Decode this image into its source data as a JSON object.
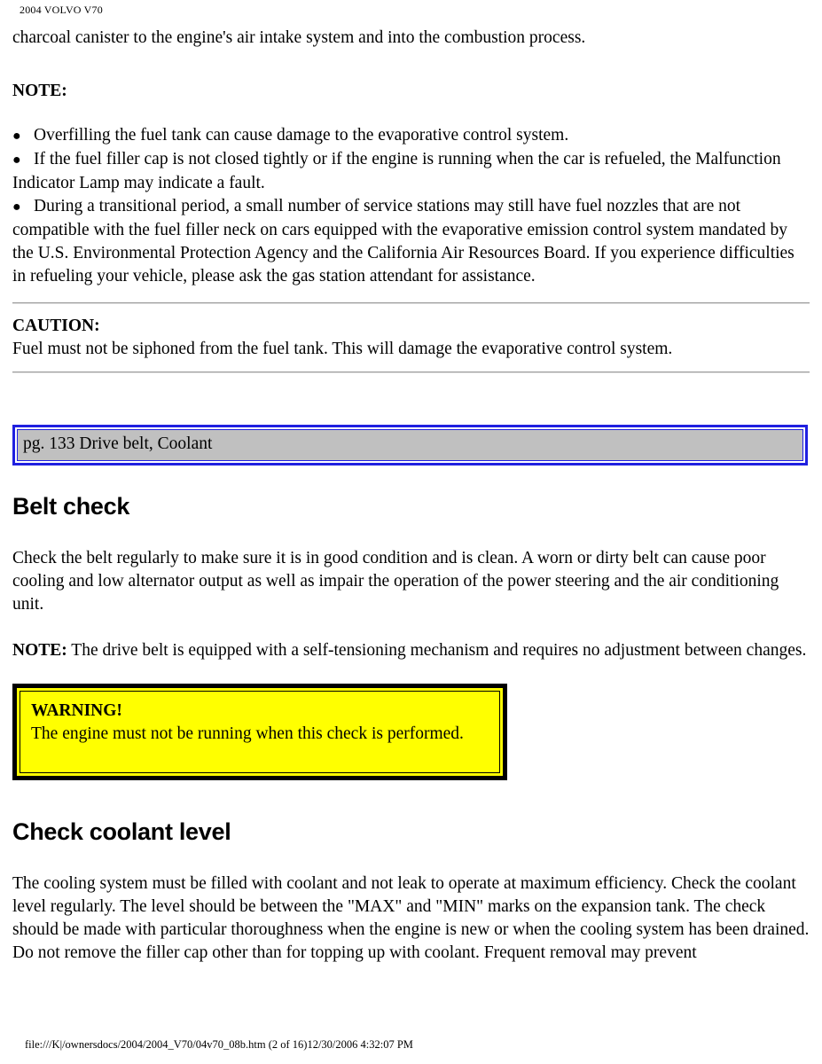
{
  "document": {
    "running_head": "2004 VOLVO V70",
    "footer": "file:///K|/ownersdocs/2004/2004_V70/04v70_08b.htm (2 of 16)12/30/2006 4:32:07 PM"
  },
  "colors": {
    "marker_border": "#2020e0",
    "marker_fill": "#c0c0c0",
    "warning_fill": "#ffff00",
    "warning_border": "#000000",
    "rule": "#9a9a9a",
    "text": "#000000",
    "page_background": "#ffffff"
  },
  "intro": {
    "continued_paragraph": "charcoal canister to the engine's air intake system and into the combustion process."
  },
  "note_section": {
    "heading": "NOTE:",
    "bullet_glyph": "●",
    "bullets": [
      "Overfilling the fuel tank can cause damage to the evaporative control system.",
      "If the fuel filler cap is not closed tightly or if the engine is running when the car is refueled, the Malfunction Indicator Lamp may indicate a fault.",
      "During a transitional period, a small number of service stations may still have fuel nozzles that are not compatible with the fuel filler neck on cars equipped with the evaporative emission control system mandated by the U.S. Environmental Protection Agency and the California Air Resources Board. If you experience difficulties in refueling your vehicle, please ask the gas station attendant for assistance."
    ]
  },
  "caution_section": {
    "heading": "CAUTION:",
    "text": "Fuel must not be siphoned from the fuel tank. This will damage the evaporative control system."
  },
  "page_marker": {
    "label": "pg. 133 Drive belt, Coolant"
  },
  "belt_check": {
    "heading": "Belt check",
    "paragraph": "Check the belt regularly to make sure it is in good condition and is clean. A worn or dirty belt can cause poor cooling and low alternator output as well as impair the operation of the power steering and the air conditioning unit.",
    "note_label": "NOTE:",
    "note_text": " The drive belt is equipped with a self-tensioning mechanism and requires no adjustment between changes."
  },
  "warning": {
    "title": "WARNING!",
    "text": "The engine must not be running when this check is performed."
  },
  "coolant_section": {
    "heading": "Check coolant level",
    "paragraph_1": "The cooling system must be filled with coolant and not leak to operate at maximum efficiency. Check the coolant level regularly. The level should be between the \"MAX\" and \"MIN\" marks on the expansion tank. The check should be made with particular thoroughness when the engine is new or when the cooling system has been drained.",
    "paragraph_2": "Do not remove the filler cap other than for topping up with coolant. Frequent removal may prevent"
  }
}
